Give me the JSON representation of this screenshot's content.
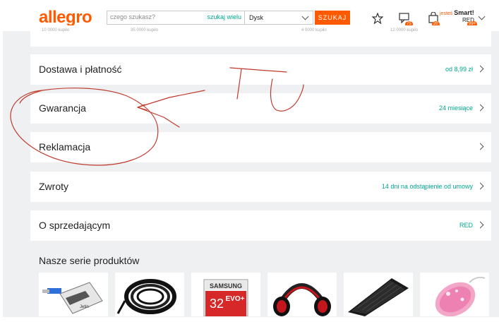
{
  "header": {
    "logo": "allegro",
    "search_placeholder": "czego szukasz?",
    "search_many": "szukaj wielu",
    "category": "Dysk",
    "search_button": "SZUKAJ",
    "messages_count": "75",
    "cart_count": "20",
    "user_prefix": "jesteś",
    "user_smart": "Smart!",
    "user_name": "RED",
    "user_badge": "99+"
  },
  "stub_row": [
    "10 0000 kupiło",
    "35 0000 kupiło",
    "4 0000 kupiło",
    "12 0000 kupiło"
  ],
  "rows": [
    {
      "title": "Dostawa i płatność",
      "value": "od 8,99 zł"
    },
    {
      "title": "Gwarancja",
      "value": "24 miesiące"
    },
    {
      "title": "Reklamacja",
      "value": ""
    },
    {
      "title": "Zwroty",
      "value": "14 dni na odstąpienie od umowy"
    },
    {
      "title": "O sprzedającym",
      "value": "RED"
    }
  ],
  "series_title": "Nasze serie produktów",
  "products": [
    {
      "name": "card-reader",
      "text": "Jetin"
    },
    {
      "name": "cable-coil",
      "text": ""
    },
    {
      "name": "memory-card",
      "brand": "SAMSUNG",
      "size": "32",
      "line": "EVO+"
    },
    {
      "name": "headphones",
      "text": ""
    },
    {
      "name": "keyboard",
      "text": ""
    },
    {
      "name": "crystal-mouse",
      "text": ""
    }
  ],
  "annotation_color": "#c0392b"
}
